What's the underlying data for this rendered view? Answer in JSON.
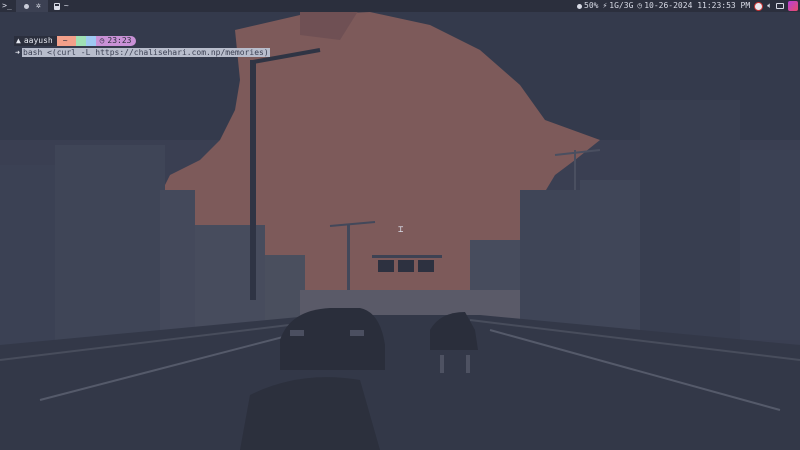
{
  "topbar": {
    "launcher_icon": "terminal-prompt-icon",
    "workspace_icons": [
      "circle-dot-icon",
      "gear-icon"
    ],
    "window_icon": "terminal-icon",
    "window_title": "~",
    "battery": "50%",
    "memory": "1G/3G",
    "datetime": "10-26-2024 11:23:53 PM",
    "system_icons": [
      "app-indicator-icon",
      "volume-icon",
      "display-icon",
      "power-icon"
    ]
  },
  "terminal": {
    "user": "aayush",
    "dir": "~",
    "time": "23:23",
    "command": "bash <(curl -L https://chalisehari.com.np/memories)"
  },
  "colors": {
    "bar_bg": "#2b2f3d",
    "seg_home": "#f3a08a",
    "seg_green": "#9fe0b5",
    "seg_blue": "#9ec9f2",
    "seg_time": "#c991d6",
    "wallpaper_sky": "#3a3f52",
    "wallpaper_sun": "#7d5a5a"
  }
}
